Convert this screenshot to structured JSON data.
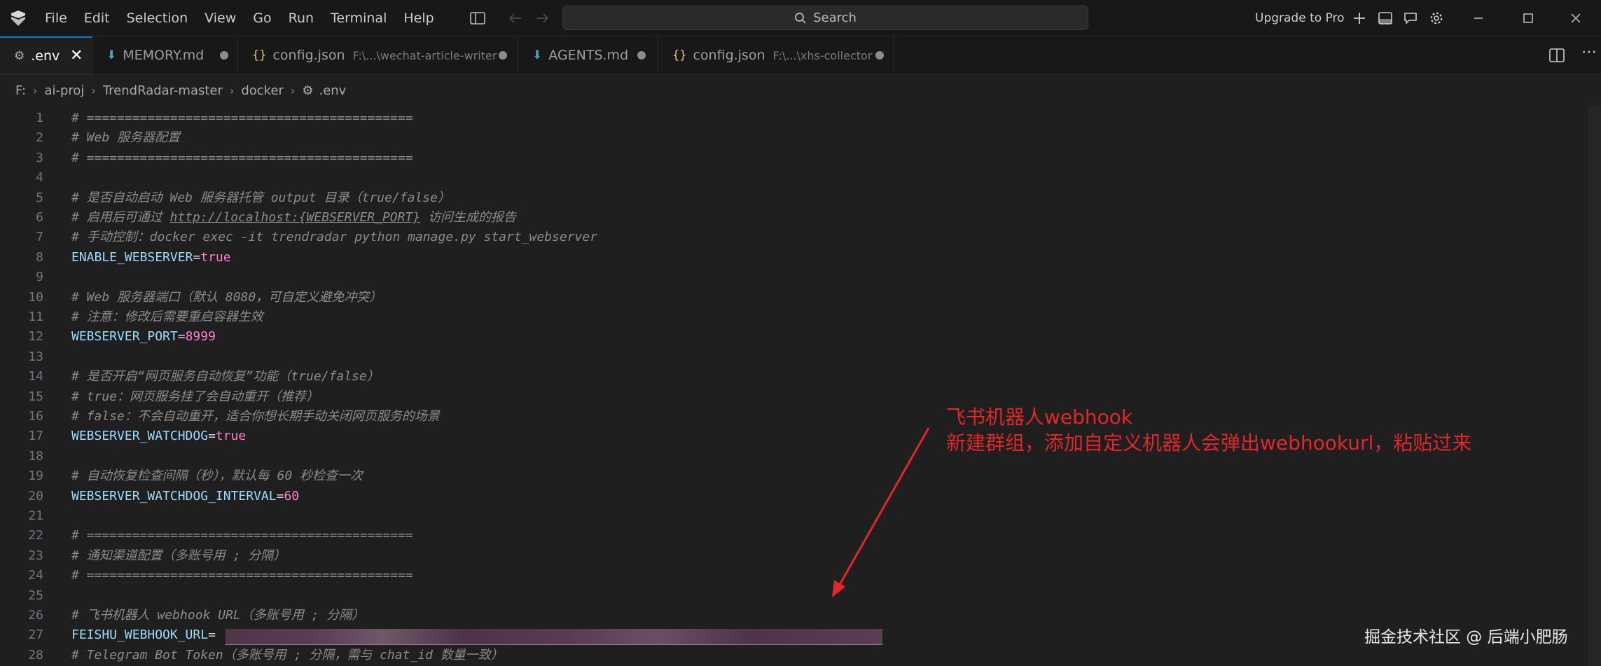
{
  "menu": [
    "File",
    "Edit",
    "Selection",
    "View",
    "Go",
    "Run",
    "Terminal",
    "Help"
  ],
  "search": {
    "placeholder": "Search"
  },
  "upgrade_label": "Upgrade to Pro",
  "tabs": [
    {
      "label": ".env",
      "desc": "",
      "icon": "gear-icon",
      "active": true
    },
    {
      "label": "MEMORY.md",
      "desc": "",
      "icon": "markdown-icon",
      "active": false
    },
    {
      "label": "config.json",
      "desc": "F:\\...\\wechat-article-writer",
      "icon": "json-braces-icon",
      "active": false
    },
    {
      "label": "AGENTS.md",
      "desc": "",
      "icon": "markdown-icon",
      "active": false
    },
    {
      "label": "config.json",
      "desc": "F:\\...\\xhs-collector",
      "icon": "json-braces-icon",
      "active": false
    }
  ],
  "breadcrumb": [
    "F:",
    "ai-proj",
    "TrendRadar-master",
    "docker",
    ".env"
  ],
  "code_lines": [
    {
      "n": "1",
      "type": "comment",
      "text": "# ==========================================="
    },
    {
      "n": "2",
      "type": "comment",
      "text": "# Web 服务器配置"
    },
    {
      "n": "3",
      "type": "comment",
      "text": "# ==========================================="
    },
    {
      "n": "4",
      "type": "blank",
      "text": ""
    },
    {
      "n": "5",
      "type": "comment",
      "text": "# 是否自动启动 Web 服务器托管 output 目录（true/false）"
    },
    {
      "n": "6",
      "type": "comment_url",
      "pre": "# 启用后可通过 ",
      "url": "http://localhost:{WEBSERVER_PORT}",
      "post": " 访问生成的报告"
    },
    {
      "n": "7",
      "type": "comment",
      "text": "# 手动控制：docker exec -it trendradar python manage.py start_webserver"
    },
    {
      "n": "8",
      "type": "kv",
      "key": "ENABLE_WEBSERVER",
      "value": "true"
    },
    {
      "n": "9",
      "type": "blank",
      "text": ""
    },
    {
      "n": "10",
      "type": "comment",
      "text": "# Web 服务器端口（默认 8080，可自定义避免冲突）"
    },
    {
      "n": "11",
      "type": "comment",
      "text": "# 注意：修改后需要重启容器生效"
    },
    {
      "n": "12",
      "type": "kv",
      "key": "WEBSERVER_PORT",
      "value": "8999"
    },
    {
      "n": "13",
      "type": "blank",
      "text": ""
    },
    {
      "n": "14",
      "type": "comment",
      "text": "# 是否开启“网页服务自动恢复”功能（true/false）"
    },
    {
      "n": "15",
      "type": "comment",
      "text": "# true：网页服务挂了会自动重开（推荐）"
    },
    {
      "n": "16",
      "type": "comment",
      "text": "# false：不会自动重开，适合你想长期手动关闭网页服务的场景"
    },
    {
      "n": "17",
      "type": "kv",
      "key": "WEBSERVER_WATCHDOG",
      "value": "true"
    },
    {
      "n": "18",
      "type": "blank",
      "text": ""
    },
    {
      "n": "19",
      "type": "comment",
      "text": "# 自动恢复检查间隔（秒），默认每 60 秒检查一次"
    },
    {
      "n": "20",
      "type": "kv",
      "key": "WEBSERVER_WATCHDOG_INTERVAL",
      "value": "60"
    },
    {
      "n": "21",
      "type": "blank",
      "text": ""
    },
    {
      "n": "22",
      "type": "comment",
      "text": "# ==========================================="
    },
    {
      "n": "23",
      "type": "comment",
      "text": "# 通知渠道配置（多账号用 ; 分隔）"
    },
    {
      "n": "24",
      "type": "comment",
      "text": "# ==========================================="
    },
    {
      "n": "25",
      "type": "blank",
      "text": ""
    },
    {
      "n": "26",
      "type": "comment",
      "text": "# 飞书机器人 webhook URL（多账号用 ; 分隔）"
    },
    {
      "n": "27",
      "type": "kv",
      "key": "FEISHU_WEBHOOK_URL",
      "value": ""
    },
    {
      "n": "28",
      "type": "comment",
      "text": "# Telegram Bot Token（多账号用 ; 分隔，需与 chat_id 数量一致）"
    }
  ],
  "annotation": {
    "line1": "飞书机器人webhook",
    "line2": "新建群组，添加自定义机器人会弹出webhookurl，粘贴过来",
    "color": "#e0272a"
  },
  "watermark": "掘金技术社区 @ 后端小肥肠",
  "colors": {
    "accent": "#0078d4",
    "editor_bg": "#1f1f1f",
    "env_key": "#9cdcfe",
    "env_value": "#ff7cd4"
  }
}
